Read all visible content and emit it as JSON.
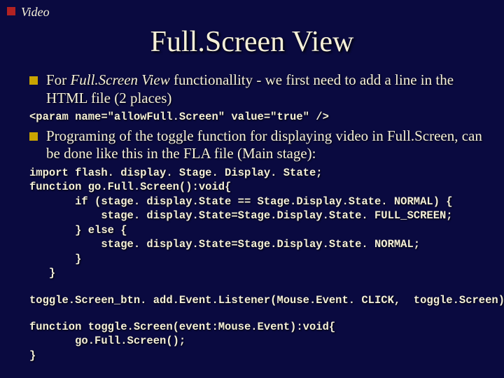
{
  "crumb": "Video",
  "title": "Full.Screen View",
  "bullets": [
    {
      "prefix": "For ",
      "em": "Full.Screen View",
      "rest": " functionallity - we first need to add a line in the HTML file (2 places)"
    },
    {
      "prefix": "",
      "em": "",
      "rest": "Programing of the toggle function for displaying video in Full.Screen, can be done like this in the FLA file (Main stage):"
    }
  ],
  "code1": "<param name=\"allowFull.Screen\" value=\"true\" />",
  "code2": "import flash. display. Stage. Display. State;\nfunction go.Full.Screen():void{\n       if (stage. display.State == Stage.Display.State. NORMAL) {\n           stage. display.State=Stage.Display.State. FULL_SCREEN;\n       } else {\n           stage. display.State=Stage.Display.State. NORMAL;\n       }\n   }",
  "code3": "toggle.Screen_btn. add.Event.Listener(Mouse.Event. CLICK,  toggle.Screen)",
  "code4": "function toggle.Screen(event:Mouse.Event):void{\n       go.Full.Screen();\n}"
}
